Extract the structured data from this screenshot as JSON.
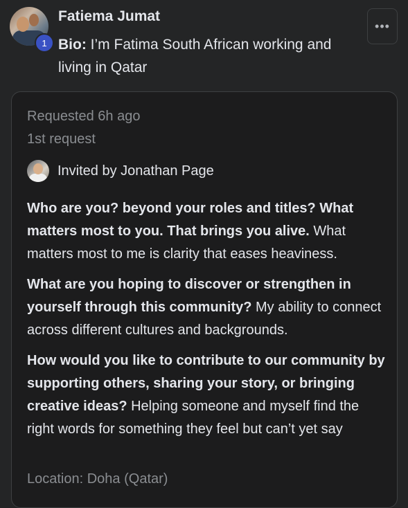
{
  "header": {
    "name": "Fatiema Jumat",
    "badge_count": "1",
    "bio_label": "Bio:",
    "bio_text": " I’m Fatima South African working and living in Qatar",
    "more_button_label": "•••"
  },
  "request": {
    "requested": "Requested 6h ago",
    "request_number": "1st request",
    "invited_by": "Invited by Jonathan Page",
    "answers": [
      {
        "question": "Who are you? beyond your roles and titles? What matters most to you. That brings you alive.",
        "answer": "  What matters most to me is clarity that eases heaviness."
      },
      {
        "question": "What are you hoping to discover or strengthen in yourself through this community?",
        "answer": "  My ability to connect across different cultures and backgrounds."
      },
      {
        "question": "How would you like to contribute to our community by supporting others, sharing your story, or bringing creative ideas?",
        "answer": "  Helping someone and myself find the right words for something they feel but can’t yet say"
      }
    ],
    "location": "Location: Doha (Qatar)"
  },
  "colors": {
    "background": "#242526",
    "card": "#1c1c1d",
    "badge": "#3a52c4",
    "secondary_text": "#8a8d91"
  }
}
